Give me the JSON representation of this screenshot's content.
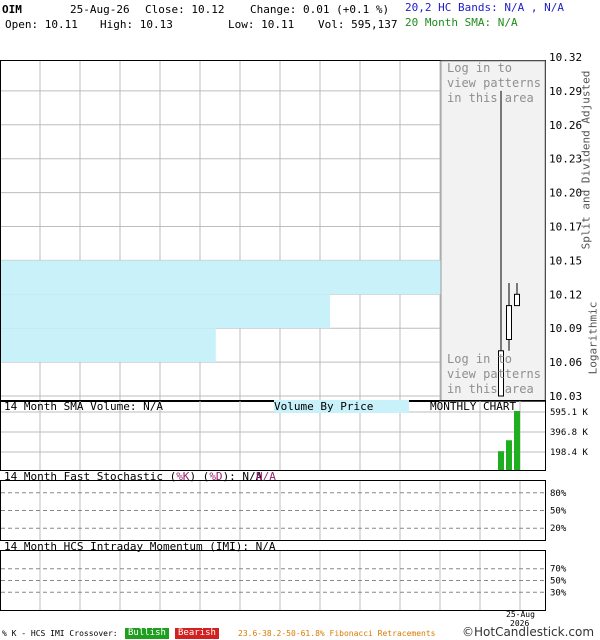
{
  "header": {
    "symbol": "OIM",
    "date": "25-Aug-26",
    "close": "Close: 10.12",
    "change": "Change: 0.01 (+0.1 %)",
    "open": "Open: 10.11",
    "high": "High: 10.13",
    "low": "Low: 10.11",
    "vol": "Vol: 595,137",
    "hc_bands": "20,2 HC Bands: N/A , N/A",
    "sma20": "20 Month SMA: N/A"
  },
  "side_labels": {
    "adjusted": "Split and Dividend Adjusted",
    "log": "Logarithmic"
  },
  "login_text": [
    "Log in to",
    "view patterns",
    "in this area"
  ],
  "panels": {
    "volume_title": "14 Month SMA Volume: N/A",
    "vbp_title": "Volume By Price",
    "period": "MONTHLY CHART",
    "stoch_title": "14 Month Fast Stochastic (",
    "stoch_k": "%K",
    "stoch_d": "%D",
    "stoch_value": "): N/A",
    "stoch_na2": "N/A",
    "imi_title": "14 Month HCS Intraday Momentum (IMI): N/A"
  },
  "footer": {
    "crossover": "% K - HCS IMI Crossover:",
    "bullish": "Bullish",
    "bearish": "Bearish",
    "fib": "23.6-38.2-50-61.8% Fibonacci Retracements",
    "brand": "©HotCandlestick.com",
    "x_date": "25-Aug",
    "x_year": "2026"
  },
  "colors": {
    "up_volume": "#1fae1f",
    "vbp_fill": "#c9f1fa",
    "login_bg": "#f2f2f2",
    "grid": "#bdbdbd",
    "bullish_bg": "#1f9e1f",
    "bearish_bg": "#d42020",
    "fib_text": "#d97a00"
  },
  "chart_data": {
    "type": "candlestick",
    "price_axis": {
      "ticks": [
        "10.32",
        "10.29",
        "10.26",
        "10.23",
        "10.20",
        "10.17",
        "10.15",
        "10.12",
        "10.09",
        "10.06",
        "10.03"
      ],
      "range": [
        10.03,
        10.32
      ],
      "scale": "log"
    },
    "candles": [
      {
        "open": 10.03,
        "high": 10.29,
        "low": 10.03,
        "close": 10.07
      },
      {
        "open": 10.08,
        "high": 10.13,
        "low": 10.07,
        "close": 10.11
      },
      {
        "open": 10.11,
        "high": 10.13,
        "low": 10.11,
        "close": 10.12
      }
    ],
    "volume_by_price": [
      {
        "price_low": 10.12,
        "price_high": 10.15,
        "share": 1.0
      },
      {
        "price_low": 10.09,
        "price_high": 10.12,
        "share": 0.72
      },
      {
        "price_low": 10.06,
        "price_high": 10.09,
        "share": 0.47
      }
    ],
    "volume": {
      "ticks": [
        "595.1 K",
        "396.8 K",
        "198.4 K"
      ],
      "range": [
        0,
        595100
      ],
      "bars": [
        190000,
        300000,
        400000,
        595137
      ]
    },
    "stochastic": {
      "ticks": [
        "80%",
        "50%",
        "20%"
      ],
      "levels": [
        80,
        50,
        20
      ]
    },
    "imi": {
      "ticks": [
        "70%",
        "50%",
        "30%"
      ],
      "levels": [
        70,
        50,
        30
      ]
    },
    "x_labels": [
      "25-Aug",
      "2026"
    ]
  }
}
